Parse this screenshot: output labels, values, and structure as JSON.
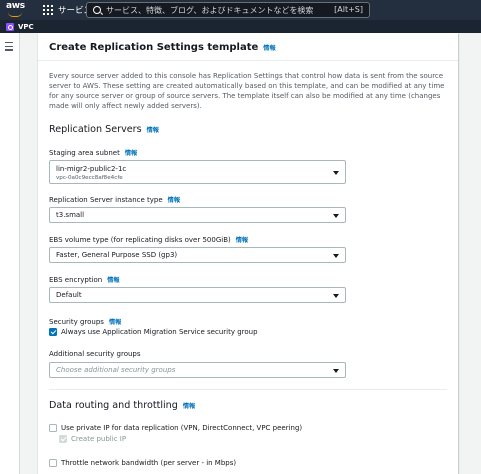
{
  "topbar": {
    "logo_text": "aws",
    "services_label": "サービス",
    "search_placeholder": "サービス、特徴、ブログ、およびドキュメントなどを検索",
    "search_shortcut": "[Alt+S]"
  },
  "subbar": {
    "service_label": "VPC"
  },
  "form": {
    "title": "Create Replication Settings template",
    "info": "情報",
    "description": "Every source server added to this console has Replication Settings that control how data is sent from the source server to AWS. These setting are created automatically based on this template, and can be modified at any time for any source server or group of source servers. The template itself can also be modified at any time (changes made will only affect newly added servers).",
    "replication_servers": {
      "title": "Replication Servers",
      "staging_subnet": {
        "label": "Staging area subnet",
        "value": "lin-migr2-public2-1c",
        "subvalue": "vpc-0a0c9ecc8af8e4cfe"
      },
      "instance_type": {
        "label": "Replication Server instance type",
        "value": "t3.small"
      },
      "ebs_volume_type": {
        "label": "EBS volume type (for replicating disks over 500GiB)",
        "value": "Faster, General Purpose SSD (gp3)"
      },
      "ebs_encryption": {
        "label": "EBS encryption",
        "value": "Default"
      },
      "security_groups": {
        "label": "Security groups",
        "checkbox_label": "Always use Application Migration Service security group",
        "checked": true
      },
      "additional_security_groups": {
        "label": "Additional security groups",
        "placeholder": "Choose additional security groups"
      }
    },
    "data_routing": {
      "title": "Data routing and throttling",
      "private_ip_label": "Use private IP for data replication (VPN, DirectConnect, VPC peering)",
      "private_ip_checked": false,
      "public_ip_label": "Create public IP",
      "public_ip_checked": true,
      "throttle_label": "Throttle network bandwidth (per server - in Mbps)",
      "throttle_checked": false
    }
  },
  "colors": {
    "topbar": "#232f3e",
    "link": "#0073bb",
    "accent": "#ff9900",
    "vpc": "#8c4fff"
  }
}
